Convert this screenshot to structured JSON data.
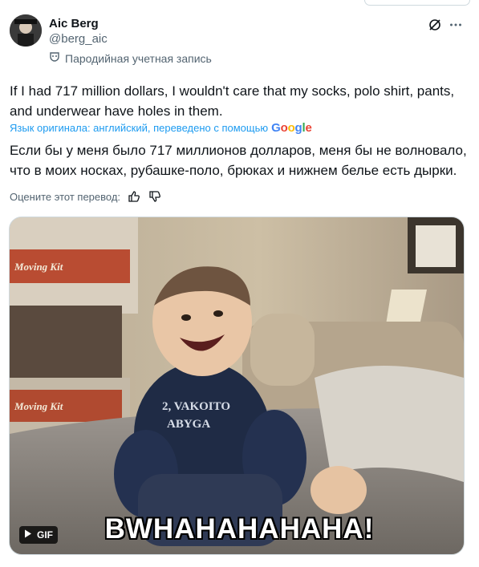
{
  "author": {
    "name": "Aic Berg",
    "handle": "@berg_aic",
    "parody_label": "Пародийная учетная запись"
  },
  "tweet": {
    "text": "If I had 717 million dollars, I wouldn't care that my socks, polo shirt, pants, and underwear have holes in them.",
    "translated_label": "Язык оригинала: английский, переведено с помощью",
    "translator_brand": "Google",
    "translation": "Если бы у меня было 717 миллионов долларов, меня бы не волновало, что в моих носках, рубашке-поло, брюках и нижнем белье есть дырки.",
    "rate_label": "Оцените этот перевод:"
  },
  "media": {
    "gif_badge": "GIF",
    "caption": "BWHAHAHAHAHA!",
    "box_text_1": "Moving Kit",
    "box_text_2": "Moving Kit",
    "shirt_text_1": "2, VAKOITO",
    "shirt_text_2": "ABYGA"
  },
  "icons": [
    "grok-icon",
    "more-icon",
    "parody-mask-icon",
    "thumbs-up-icon",
    "thumbs-down-icon",
    "play-icon"
  ],
  "colors": {
    "text_primary": "#0f1419",
    "text_secondary": "#536471",
    "link": "#1d9bf0"
  }
}
